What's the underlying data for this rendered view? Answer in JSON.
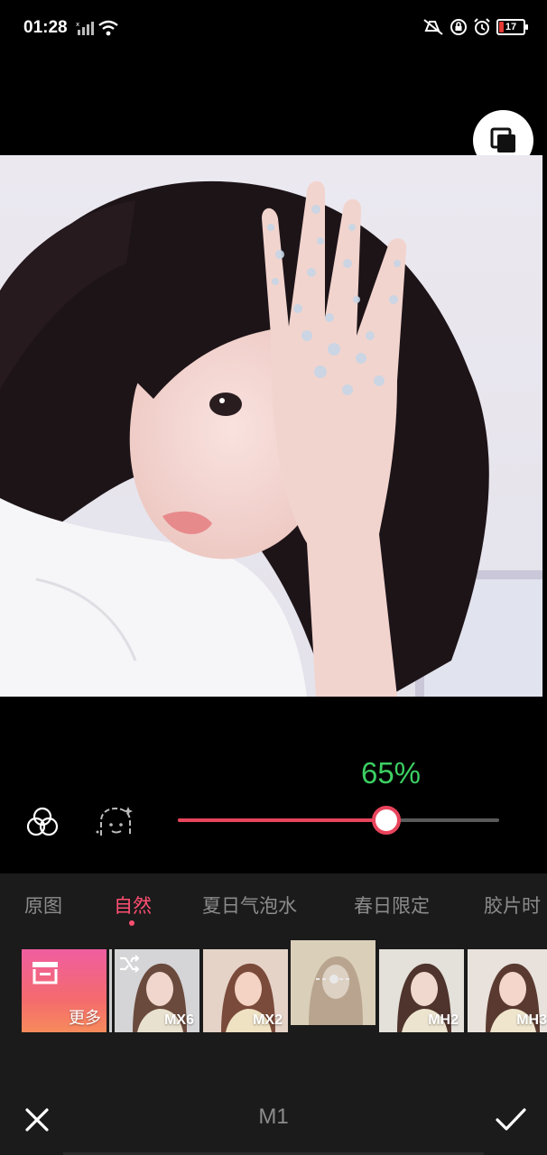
{
  "status_bar": {
    "time": "01:28",
    "battery": "17",
    "left_icons": [
      "signal-icon",
      "wifi-icon"
    ],
    "right_icons": [
      "mute-icon",
      "lock-icon",
      "alarm-icon",
      "battery-icon"
    ]
  },
  "photo": {
    "compare_icon": "compare-icon"
  },
  "adjust": {
    "intensity": "65%",
    "intensity_value": 0.65,
    "tool_icons": [
      "filter-circles-icon",
      "face-beauty-icon"
    ]
  },
  "tabs": [
    {
      "label": "原图",
      "active": false
    },
    {
      "label": "自然",
      "active": true
    },
    {
      "label": "夏日气泡水",
      "active": false
    },
    {
      "label": "春日限定",
      "active": false
    },
    {
      "label": "胶片时",
      "active": false
    }
  ],
  "filters": {
    "more_label": "更多",
    "items": [
      {
        "label": "MX6",
        "icon": "shuffle-icon"
      },
      {
        "label": "MX2"
      },
      {
        "label": "",
        "icon": "adjust-slider-icon",
        "selected": true
      },
      {
        "label": "MH2"
      },
      {
        "label": "MH3"
      }
    ]
  },
  "bottom": {
    "filter_name": "M1",
    "close_icon": "close-icon",
    "confirm_icon": "check-icon"
  },
  "colors": {
    "accent": "#ff4f72",
    "slider": "#e8445c",
    "percent": "#3ccf62",
    "panel": "#1b1b1b"
  }
}
